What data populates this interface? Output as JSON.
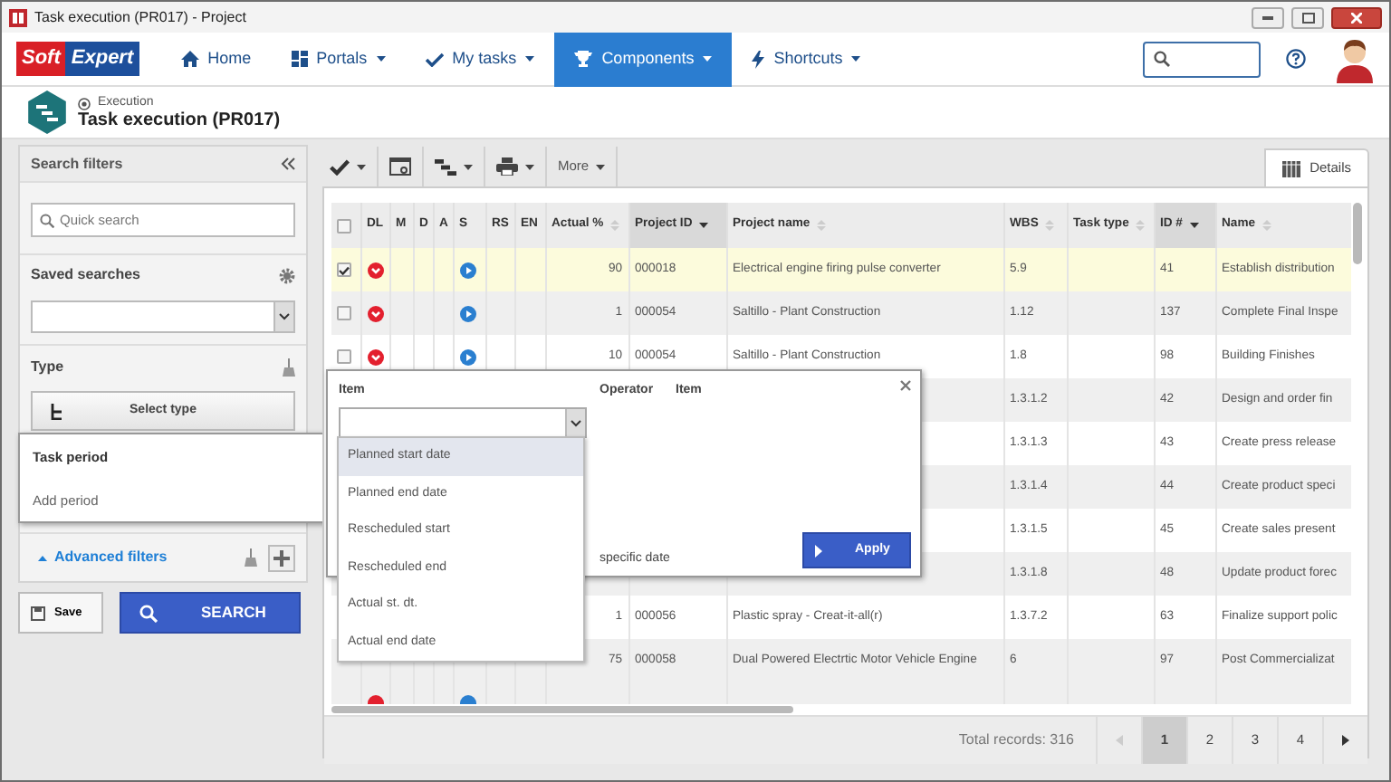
{
  "window": {
    "title": "Task execution (PR017) - Project"
  },
  "navbar": {
    "logo": [
      "Soft",
      "Expert"
    ],
    "items": [
      {
        "label": "Home",
        "dropdown": false,
        "selected": false
      },
      {
        "label": "Portals",
        "dropdown": true,
        "selected": false
      },
      {
        "label": "My tasks",
        "dropdown": true,
        "selected": false
      },
      {
        "label": "Components",
        "dropdown": true,
        "selected": true
      },
      {
        "label": "Shortcuts",
        "dropdown": true,
        "selected": false
      }
    ]
  },
  "page_header": {
    "breadcrumb": "Execution",
    "title": "Task execution (PR017)"
  },
  "filters": {
    "title": "Search filters",
    "quick_search": {
      "placeholder": "Quick search"
    },
    "saved_searches": "Saved searches",
    "type": {
      "label": "Type",
      "button": "Select type"
    },
    "task_period": {
      "label": "Task period",
      "action": "Add period"
    },
    "advanced": {
      "label": "Advanced filters",
      "expanded": true
    },
    "save": "Save",
    "search": "SEARCH"
  },
  "toolbar": {
    "more": "More",
    "tab": {
      "label": "Details",
      "selected": true
    }
  },
  "table": {
    "all_checked": false,
    "columns": [
      {
        "label": "DL",
        "sorted": false
      },
      {
        "label": "M",
        "sorted": false
      },
      {
        "label": "D",
        "sorted": false
      },
      {
        "label": "A",
        "sorted": false
      },
      {
        "label": "S",
        "sorted": false
      },
      {
        "label": "RS",
        "sorted": false
      },
      {
        "label": "EN",
        "sorted": false
      },
      {
        "label": "Actual %",
        "sortable": true,
        "sorted": false
      },
      {
        "label": "Project ID",
        "sortable": true,
        "sorted": true
      },
      {
        "label": "Project name",
        "sortable": true,
        "sorted": false
      },
      {
        "label": "WBS",
        "sortable": true,
        "sorted": false
      },
      {
        "label": "Task type",
        "sortable": true,
        "sorted": false
      },
      {
        "label": "ID #",
        "sortable": true,
        "sorted": true
      },
      {
        "label": "Name",
        "sortable": true,
        "sorted": false
      }
    ],
    "rows": [
      {
        "selected": true,
        "checked": true,
        "dl": true,
        "s": true,
        "actual": "90",
        "project_id": "000018",
        "project_name": "Electrical engine firing pulse converter",
        "wbs": "5.9",
        "id": "41",
        "name": "Establish distribution"
      },
      {
        "selected": false,
        "checked": false,
        "dl": true,
        "s": true,
        "actual": "1",
        "project_id": "000054",
        "project_name": "Saltillo - Plant Construction",
        "wbs": "1.12",
        "id": "137",
        "name": "Complete Final Inspe"
      },
      {
        "selected": false,
        "checked": false,
        "dl": true,
        "s": true,
        "actual": "10",
        "project_id": "000054",
        "project_name": "Saltillo - Plant Construction",
        "wbs": "1.8",
        "id": "98",
        "name": "Building Finishes"
      },
      {
        "selected": false,
        "wbs": "1.3.1.2",
        "id": "42",
        "name": "Design and order fin"
      },
      {
        "selected": false,
        "wbs": "1.3.1.3",
        "id": "43",
        "name": "Create press release"
      },
      {
        "selected": false,
        "wbs": "1.3.1.4",
        "id": "44",
        "name": "Create product speci"
      },
      {
        "selected": false,
        "wbs": "1.3.1.5",
        "id": "45",
        "name": "Create sales present"
      },
      {
        "selected": false,
        "wbs": "1.3.1.8",
        "id": "48",
        "name": "Update product forec"
      },
      {
        "selected": false,
        "actual": "1",
        "project_id": "000056",
        "project_name": "Plastic spray - Creat-it-all(r)",
        "wbs": "1.3.7.2",
        "id": "63",
        "name": "Finalize support polic"
      },
      {
        "selected": false,
        "actual": "75",
        "project_id": "000058",
        "project_name": "Dual Powered Electrtic Motor Vehicle Engine",
        "wbs": "6",
        "id": "97",
        "name": "Post Commercializat"
      }
    ],
    "total": "Total records: 316",
    "pages": [
      {
        "label": "1",
        "selected": true
      },
      {
        "label": "2",
        "selected": false
      },
      {
        "label": "3",
        "selected": false
      },
      {
        "label": "4",
        "selected": false
      }
    ]
  },
  "filter_popup": {
    "headings": [
      "Item",
      "Operator",
      "Item"
    ],
    "options": [
      {
        "label": "Planned start date",
        "selected": true
      },
      {
        "label": "Planned end date",
        "selected": false
      },
      {
        "label": "Rescheduled start",
        "selected": false
      },
      {
        "label": "Rescheduled end",
        "selected": false
      },
      {
        "label": "Actual st. dt.",
        "selected": false
      },
      {
        "label": "Actual end date",
        "selected": false
      }
    ],
    "partial_text": "specific date",
    "apply": "Apply"
  }
}
